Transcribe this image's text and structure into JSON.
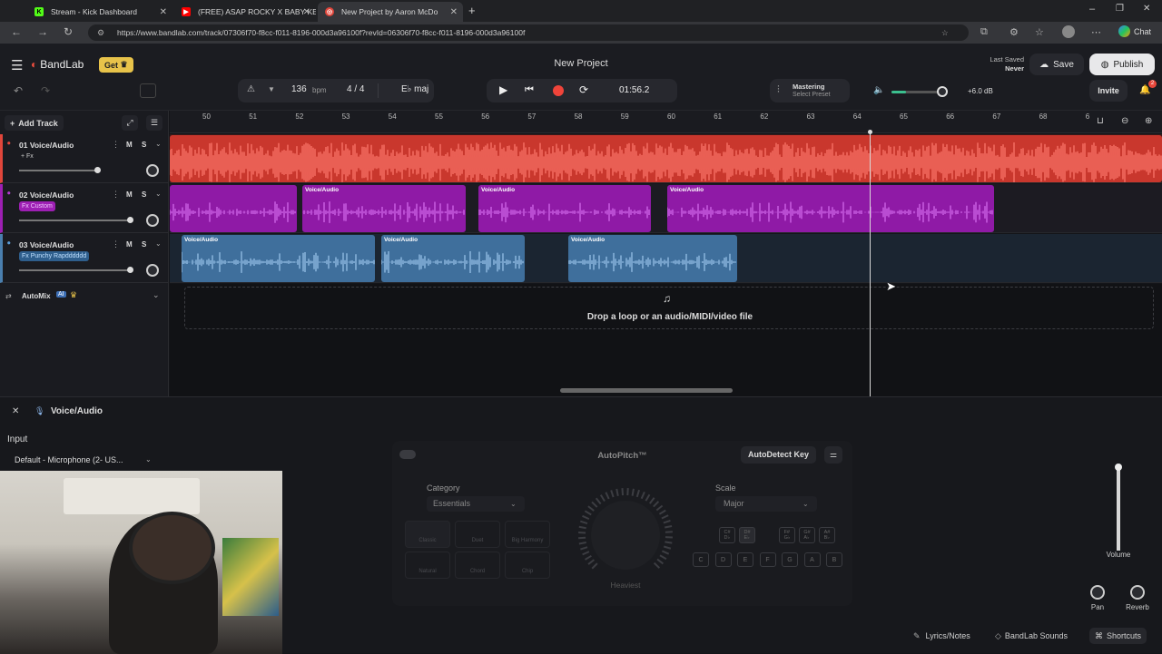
{
  "browser": {
    "tabs": [
      {
        "title": "Stream - Kick Dashboard"
      },
      {
        "title": "(FREE) ASAP ROCKY X BABY KEEM"
      },
      {
        "title": "New Project by Aaron McDo"
      }
    ],
    "url": "https://www.bandlab.com/track/07306f70-f8cc-f011-8196-000d3a96100f?revId=06306f70-f8cc-f011-8196-000d3a96100f",
    "chat_label": "Chat"
  },
  "app": {
    "logo": "BandLab",
    "get_label": "Get",
    "project_title": "New Project",
    "last_saved_label": "Last Saved",
    "last_saved_value": "Never",
    "save_label": "Save",
    "publish_label": "Publish",
    "invite_label": "Invite",
    "notif_count": "2"
  },
  "transport": {
    "bpm": "136",
    "bpm_unit": "bpm",
    "time_sig": "4 / 4",
    "key": "E♭ maj",
    "time": "01:56.2",
    "mastering_label": "Mastering",
    "mastering_preset": "Select Preset",
    "volume_db": "+6.0 dB"
  },
  "timeline": {
    "add_track_label": "Add Track",
    "ruler": [
      "50",
      "51",
      "52",
      "53",
      "54",
      "55",
      "56",
      "57",
      "58",
      "59",
      "60",
      "61",
      "62",
      "63",
      "64",
      "65",
      "66",
      "67",
      "68",
      "6"
    ],
    "tracks": [
      {
        "name": "01 Voice/Audio",
        "fx": "+ Fx",
        "color": "#e0463b"
      },
      {
        "name": "02 Voice/Audio",
        "fx": "Fx Custom",
        "color": "#9d1fb3"
      },
      {
        "name": "03 Voice/Audio",
        "fx": "Fx Punchy Rapdddddd",
        "color": "#4a7fae"
      }
    ],
    "mute": "M",
    "solo": "S",
    "clip_label": "Voice/Audio",
    "automix_label": "AutoMix",
    "ai_badge": "AI",
    "drop_text": "Drop a loop or an audio/MIDI/video file"
  },
  "editor": {
    "track_title": "Voice/Audio",
    "input_label": "Input",
    "input_value": "Default - Microphone (2- US...",
    "autopitch_title": "AutoPitch™",
    "autodetect_label": "AutoDetect Key",
    "category_label": "Category",
    "category_value": "Essentials",
    "presets": [
      "Classic",
      "Duet",
      "Big Harmony",
      "Natural",
      "Chord",
      "Chip"
    ],
    "knob_label": "Heaviest",
    "scale_label": "Scale",
    "scale_value": "Major",
    "sharp_keys": [
      "C#\nD♭",
      "D#\nE♭",
      "F#\nG♭",
      "G#\nA♭",
      "A#\nB♭"
    ],
    "keys": [
      "C",
      "D",
      "E",
      "F",
      "G",
      "A",
      "B"
    ],
    "volume_label": "Volume",
    "pan_label": "Pan",
    "reverb_label": "Reverb",
    "lyrics_label": "Lyrics/Notes",
    "sounds_label": "BandLab Sounds",
    "shortcuts_label": "Shortcuts"
  }
}
